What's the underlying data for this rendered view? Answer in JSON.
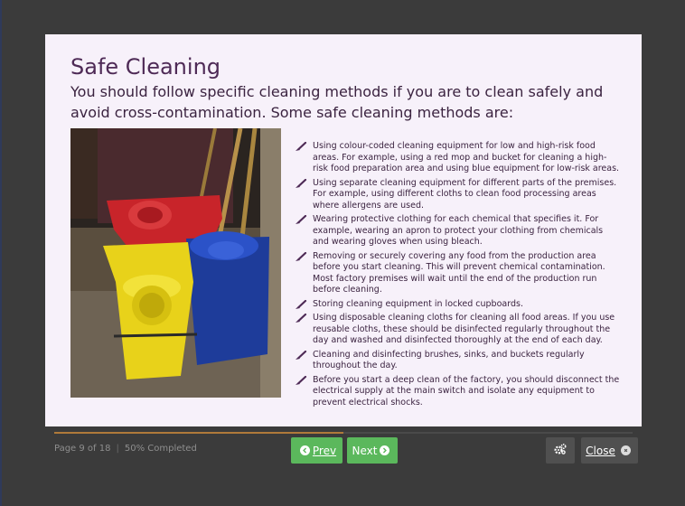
{
  "slide": {
    "title": "Safe Cleaning",
    "subtitle": "You should follow specific cleaning methods if you are to clean safely and avoid cross-contamination. Some safe cleaning methods are:",
    "image": "mop-buckets-photo",
    "bullets": [
      "Using colour-coded cleaning equipment for low and high-risk food areas. For example, using a red mop and bucket for cleaning a high-risk food preparation area and using blue equipment for low-risk areas.",
      "Using separate cleaning equipment for different parts of the premises. For example, using different cloths to clean food processing areas where allergens are used.",
      "Wearing protective clothing for each chemical that specifies it. For example, wearing an apron to protect your clothing from chemicals and wearing gloves when using bleach.",
      "Removing or securely covering any food from the production area before you start cleaning. This will prevent chemical contamination. Most factory premises will wait until the end of the production run before cleaning.",
      "Storing cleaning equipment in locked cupboards.",
      "Using disposable cleaning cloths for cleaning all food areas. If you use reusable cloths, these should be disinfected regularly throughout the day and washed and disinfected thoroughly at the end of each day.",
      "Cleaning and disinfecting brushes, sinks, and buckets regularly throughout the day.",
      "Before you start a deep clean of the factory, you should disconnect the electrical supply at the main switch and isolate any equipment to prevent electrical shocks."
    ]
  },
  "footer": {
    "page_label": "Page 9 of 18",
    "completed_label": "50% Completed",
    "progress_fraction": 0.5,
    "prev_label": "Prev",
    "next_label": "Next",
    "close_label": "Close",
    "settings_icon": "gears-icon"
  },
  "colors": {
    "background": "#3b3b3b",
    "card": "#f7f1fa",
    "title": "#4e2a56",
    "button_green": "#5bb85c",
    "button_dark": "#505050",
    "progress": "#b07a3a"
  }
}
